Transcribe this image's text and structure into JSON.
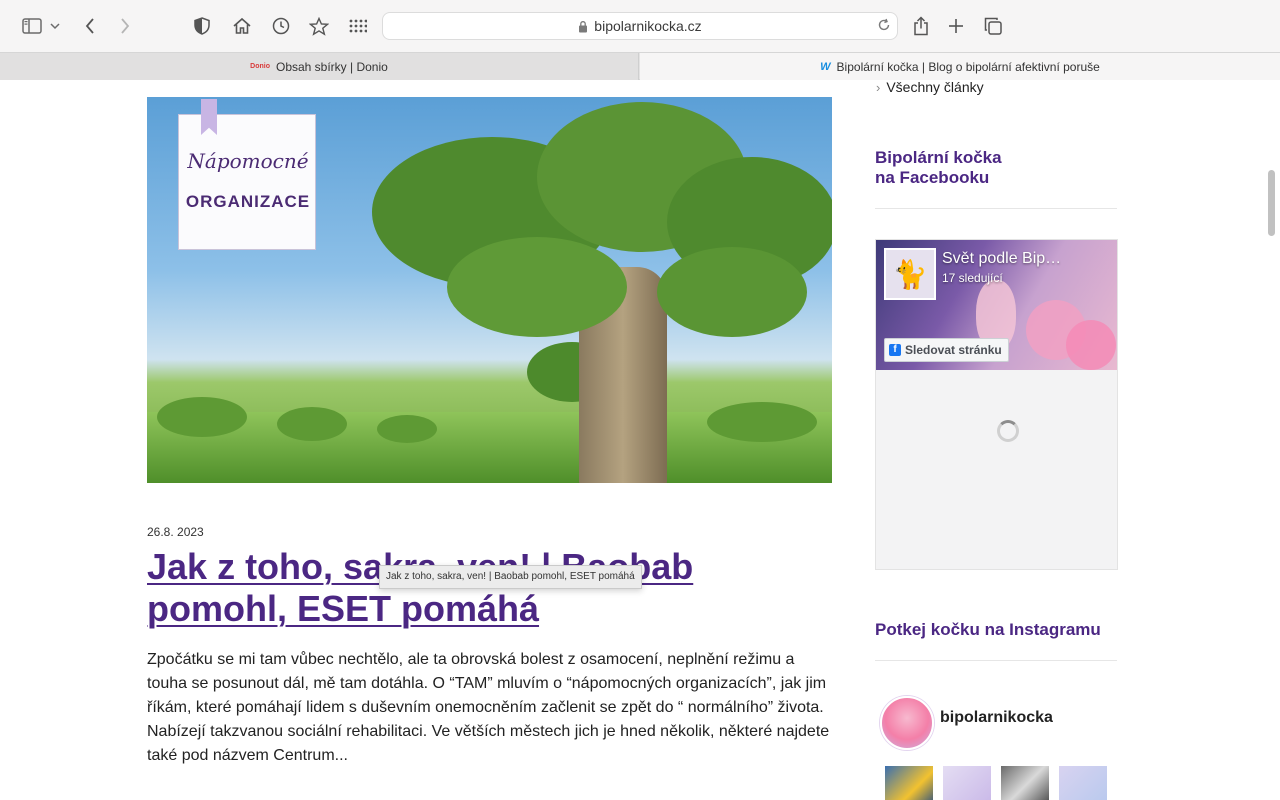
{
  "browser": {
    "address": "bipolarnikocka.cz"
  },
  "tabs": [
    {
      "favicon_text": "Donio",
      "label": "Obsah sbírky | Donio",
      "active": false
    },
    {
      "favicon_text": "W",
      "label": "Bipolární kočka | Blog o bipolární afektivní poruše",
      "active": true
    }
  ],
  "hero": {
    "badge_line1": "Nápomocné",
    "badge_line2": "ORGANIZACE"
  },
  "post": {
    "date": "26.8. 2023",
    "title": "Jak z toho, sakra, ven! | Baobab pomohl, ESET pomáhá",
    "tooltip": "Jak z toho, sakra, ven! | Baobab pomohl, ESET pomáhá",
    "excerpt": "Zpočátku se mi tam vůbec nechtělo, ale ta obrovská bolest z osamocení, neplnění režimu a touha se posunout dál, mě tam dotáhla.  O “TAM” mluvím o “nápomocných organizacích”, jak jim říkám, které pomáhají lidem s duševním onemocněním začlenit se zpět do “ normálního” života. Nabízejí takzvanou sociální rehabilitaci.  Ve větších městech jich je hned několik, některé najdete také pod názvem Centrum..."
  },
  "sidebar": {
    "all_articles": "Všechny články",
    "facebook_title_line1": "Bipolární kočka",
    "facebook_title_line2": "na Facebooku",
    "fb_page": {
      "name": "Svět podle Bip…",
      "followers": "17 sledující",
      "follow_button": "Sledovat stránku"
    },
    "instagram_title": "Potkej kočku na Instagramu",
    "instagram_user": "bipolarnikocka"
  },
  "colors": {
    "accent": "#4b2783",
    "toolbar_bg": "#f6f5f5"
  }
}
